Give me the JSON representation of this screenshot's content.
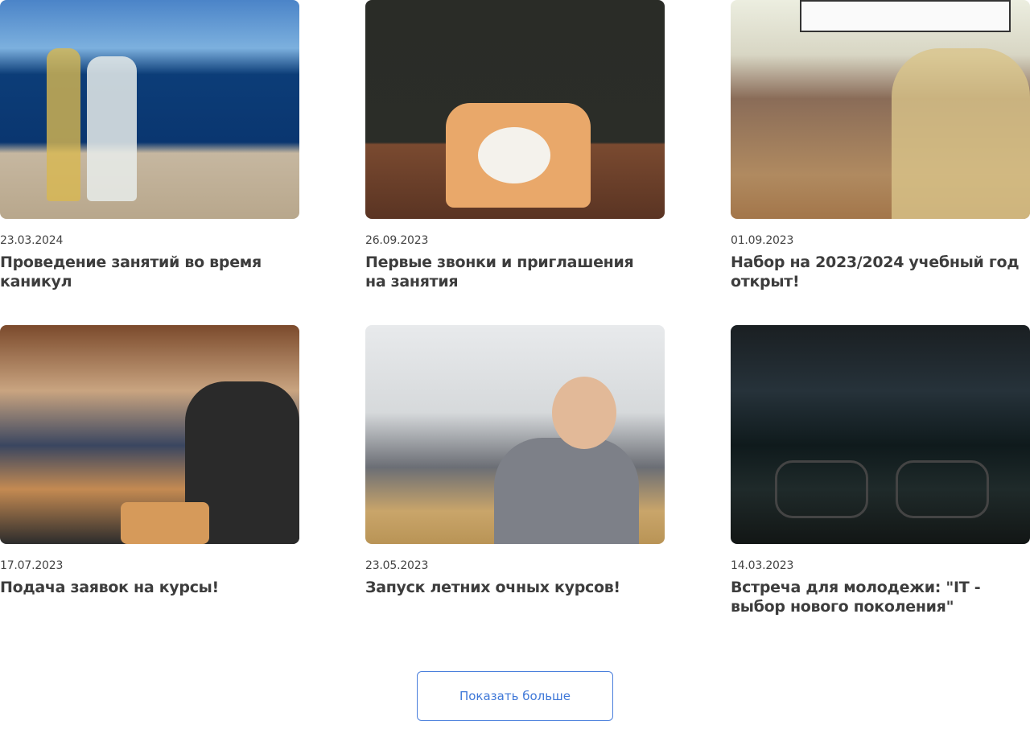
{
  "news": [
    {
      "date": "23.03.2024",
      "title": "Проведение занятий во время каникул",
      "image": "children-by-sea-photo"
    },
    {
      "date": "26.09.2023",
      "title": "Первые звонки и приглашения на занятия",
      "image": "rotary-phone-photo"
    },
    {
      "date": "01.09.2023",
      "title": "Набор на 2023/2024 учебный год открыт!",
      "image": "lecture-hall-photo"
    },
    {
      "date": "17.07.2023",
      "title": "Подача заявок на курсы!",
      "image": "auditorium-audience-photo"
    },
    {
      "date": "23.05.2023",
      "title": "Запуск летних очных курсов!",
      "image": "kids-at-computers-photo"
    },
    {
      "date": "14.03.2023",
      "title": "Встреча для молодежи: \"IT - выбор нового поколения\"",
      "image": "code-screen-glasses-photo"
    }
  ],
  "show_more_label": "Показать больше",
  "colors": {
    "accent": "#3f78d8",
    "text": "#3d3d3d"
  }
}
